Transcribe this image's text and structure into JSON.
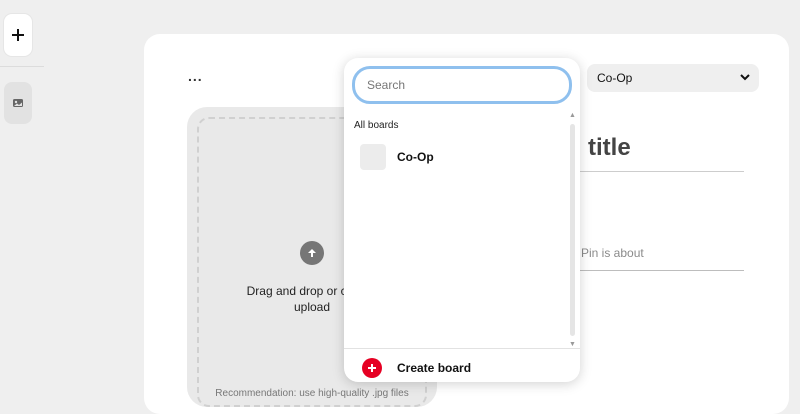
{
  "rail": {
    "add_icon": "plus-icon",
    "draft_icon": "image-icon"
  },
  "header": {
    "more_label": "..."
  },
  "upload": {
    "text": "Drag and drop or click to upload",
    "recommendation": "Recommendation: use high-quality .jpg files",
    "icon": "arrow-up-icon"
  },
  "board_select": {
    "value": "Co-Op",
    "options": [
      "Co-Op"
    ]
  },
  "form": {
    "title_placeholder": "Add your title",
    "title_visible": "title",
    "about_placeholder": "Tell everyone what your Pin is about",
    "about_visible": "ur Pin is about"
  },
  "dropdown": {
    "search_placeholder": "Search",
    "section_label": "All boards",
    "boards": [
      {
        "name": "Co-Op"
      }
    ],
    "create_label": "Create board"
  },
  "colors": {
    "accent_red": "#e60023",
    "focus_ring": "#8fc0ee",
    "background": "#efefef"
  }
}
